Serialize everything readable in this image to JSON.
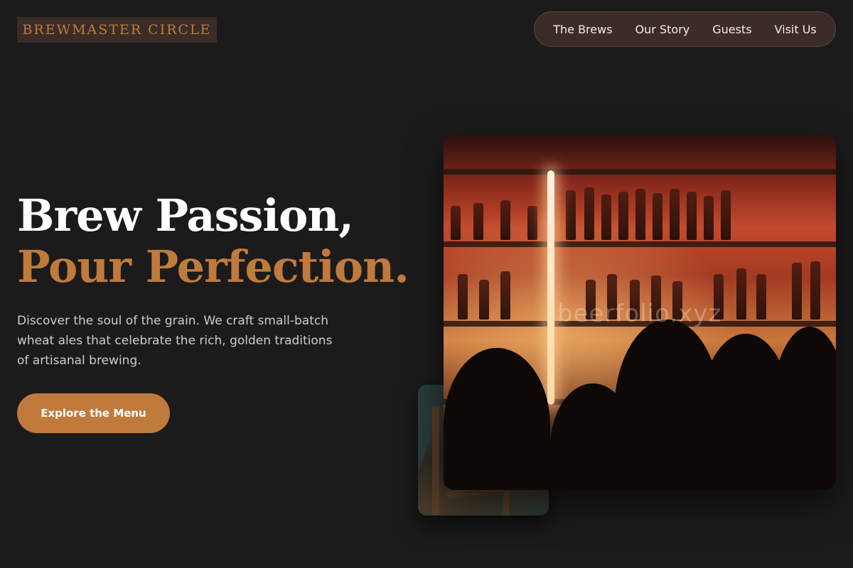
{
  "header": {
    "logo": "BREWMASTER CIRCLE",
    "nav": [
      "The Brews",
      "Our Story",
      "Guests",
      "Visit Us"
    ]
  },
  "hero": {
    "title_line1": "Brew Passion,",
    "title_line2": "Pour Perfection.",
    "description": "Discover the soul of the grain. We craft small-batch wheat ales that celebrate the rich, golden traditions of artisanal brewing.",
    "cta_label": "Explore the Menu"
  },
  "images": {
    "main_watermark": "beerfolio.xyz"
  },
  "colors": {
    "background": "#1b1b1b",
    "accent": "#c07a3c",
    "nav_bg": "#3b2c28",
    "logo_bg": "#3a2c27"
  }
}
